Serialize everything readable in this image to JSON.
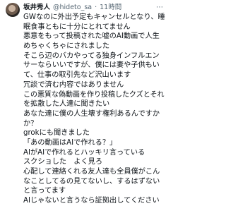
{
  "post": {
    "author_name": "坂井秀人",
    "handle": "@hideto_sa",
    "separator": "·",
    "time": "11時間",
    "more_label": "⋯",
    "lines": [
      "GWなのに外出予定もキャンセルとなり、睡",
      "眠食事ともに十分にとれてません",
      "悪意をもって投稿された嘘のAI動画で人生",
      "めちゃくちゃにされました",
      "そこら辺のバカやってる独身インフルエン",
      "サーならいいですが、僕には妻や子供もい",
      "て、仕事の取引先など沢山います",
      "冗談で済む内容ではありません",
      "この悪質な偽動画を作り投稿したクズとそれ",
      "を拡散した人達に聞きたい",
      "あなた達に僕の人生壊す権利あるんですか",
      "か？",
      "grokにも聞きました",
      "「あの動画はAIで作れる？」",
      "AIがAIで作れるとハッキリ言っている",
      "スクショした　よく見ろ",
      "心配して連絡くれる友人達も全員僕がこん",
      "なことしてるの見てないし、するはずない",
      "と言ってます",
      "AIじゃないと言うなら証拠出してください"
    ]
  }
}
